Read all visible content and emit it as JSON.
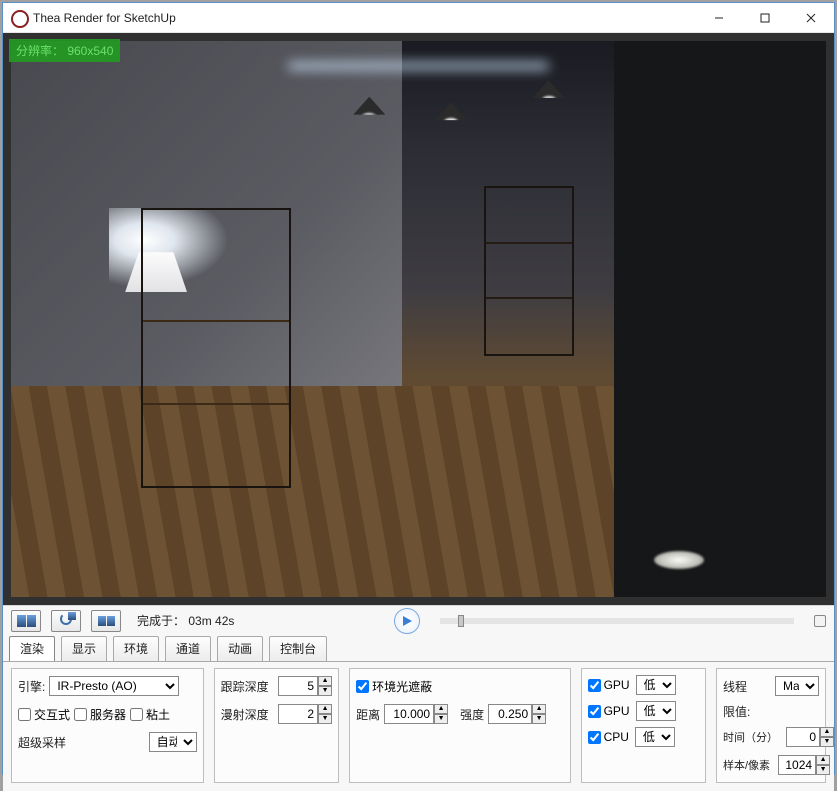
{
  "window": {
    "title": "Thea Render for SketchUp"
  },
  "viewport": {
    "resolution_label": "分辨率： 960x540"
  },
  "toolbar": {
    "status_prefix": "完成于：",
    "status_time": "03m 42s"
  },
  "tabs": {
    "items": [
      {
        "label": "渲染"
      },
      {
        "label": "显示"
      },
      {
        "label": "环境"
      },
      {
        "label": "通道"
      },
      {
        "label": "动画"
      },
      {
        "label": "控制台"
      }
    ]
  },
  "settings": {
    "engine": {
      "label": "引擎:",
      "value": "IR-Presto (AO)",
      "interactive_label": "交互式",
      "server_label": "服务器",
      "clay_label": "粘土",
      "supersample_label": "超级采样",
      "supersample_value": "自动"
    },
    "depth": {
      "trace_label": "跟踪深度",
      "trace_value": "5",
      "diffuse_label": "漫射深度",
      "diffuse_value": "2"
    },
    "ao": {
      "enable_label": "环境光遮蔽",
      "distance_label": "距离",
      "distance_value": "10.000",
      "intensity_label": "强度",
      "intensity_value": "0.250"
    },
    "processors": {
      "gpu_label": "GPU",
      "cpu_label": "CPU",
      "level_value": "低"
    },
    "threads": {
      "label": "线程",
      "max_value": "Max",
      "limit_label": "限值:",
      "time_label": "时间（分）",
      "time_value": "0",
      "samples_label": "样本/像素",
      "samples_value": "1024"
    }
  }
}
